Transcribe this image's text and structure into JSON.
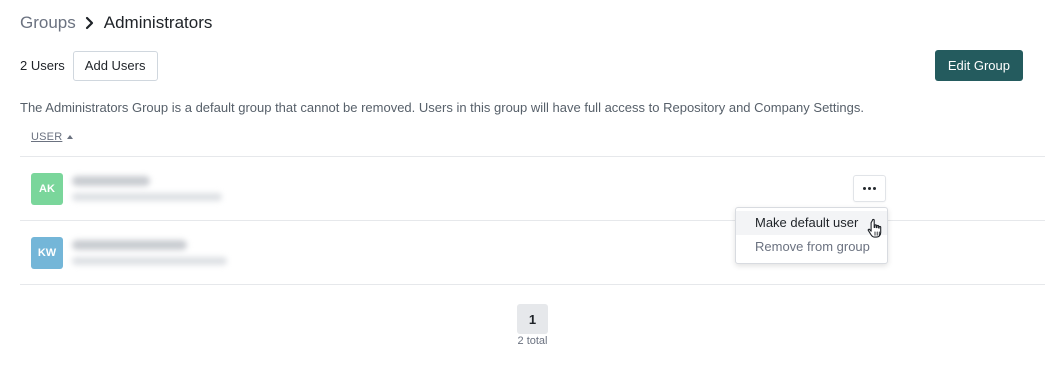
{
  "breadcrumb": {
    "parent": "Groups",
    "current": "Administrators"
  },
  "toolbar": {
    "user_count": "2 Users",
    "add_users_label": "Add Users",
    "edit_group_label": "Edit Group"
  },
  "description": "The Administrators Group is a default group that cannot be removed. Users in this group will have full access to Repository and Company Settings.",
  "table": {
    "column_user": "USER",
    "sort": "ascending",
    "rows": [
      {
        "initials": "AK",
        "avatar_color": "#7ad69b"
      },
      {
        "initials": "KW",
        "avatar_color": "#74b6d8"
      }
    ]
  },
  "row_menu": {
    "items": [
      "Make default user",
      "Remove from group"
    ],
    "hovered": "Make default user"
  },
  "pagination": {
    "current_page": "1",
    "total": "2 total"
  },
  "colors": {
    "primary": "#245b5e",
    "muted_text": "#6b7280"
  }
}
